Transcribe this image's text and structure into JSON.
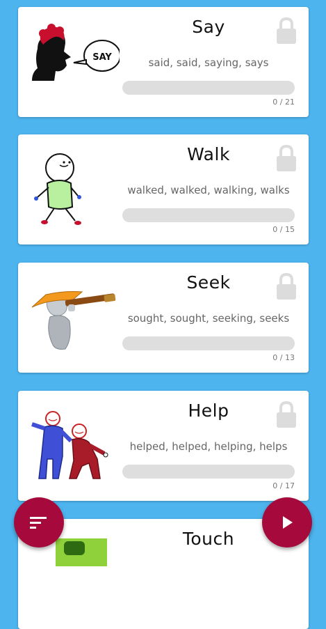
{
  "cards": [
    {
      "title": "Say",
      "forms": "said, said, saying, says",
      "progress": {
        "done": 0,
        "total": 21
      },
      "count": "0 / 21",
      "image": "speaking-person-icon",
      "locked": true
    },
    {
      "title": "Walk",
      "forms": "walked, walked, walking, walks",
      "progress": {
        "done": 0,
        "total": 15
      },
      "count": "0 / 15",
      "image": "walking-figure-icon",
      "locked": true
    },
    {
      "title": "Seek",
      "forms": "sought, sought, seeking, seeks",
      "progress": {
        "done": 0,
        "total": 13
      },
      "count": "0 / 13",
      "image": "telescope-figure-icon",
      "locked": true
    },
    {
      "title": "Help",
      "forms": "helped, helped, helping, helps",
      "progress": {
        "done": 0,
        "total": 17
      },
      "count": "0 / 17",
      "image": "helping-figures-icon",
      "locked": true
    },
    {
      "title": "Touch",
      "image": "touch-picture-icon"
    }
  ],
  "fabs": {
    "left": {
      "icon": "sort-icon"
    },
    "right": {
      "icon": "play-icon"
    }
  },
  "colors": {
    "background": "#4db4ee",
    "accent": "#a60a3d",
    "lock": "#dcdcdc",
    "track": "#dedede"
  }
}
